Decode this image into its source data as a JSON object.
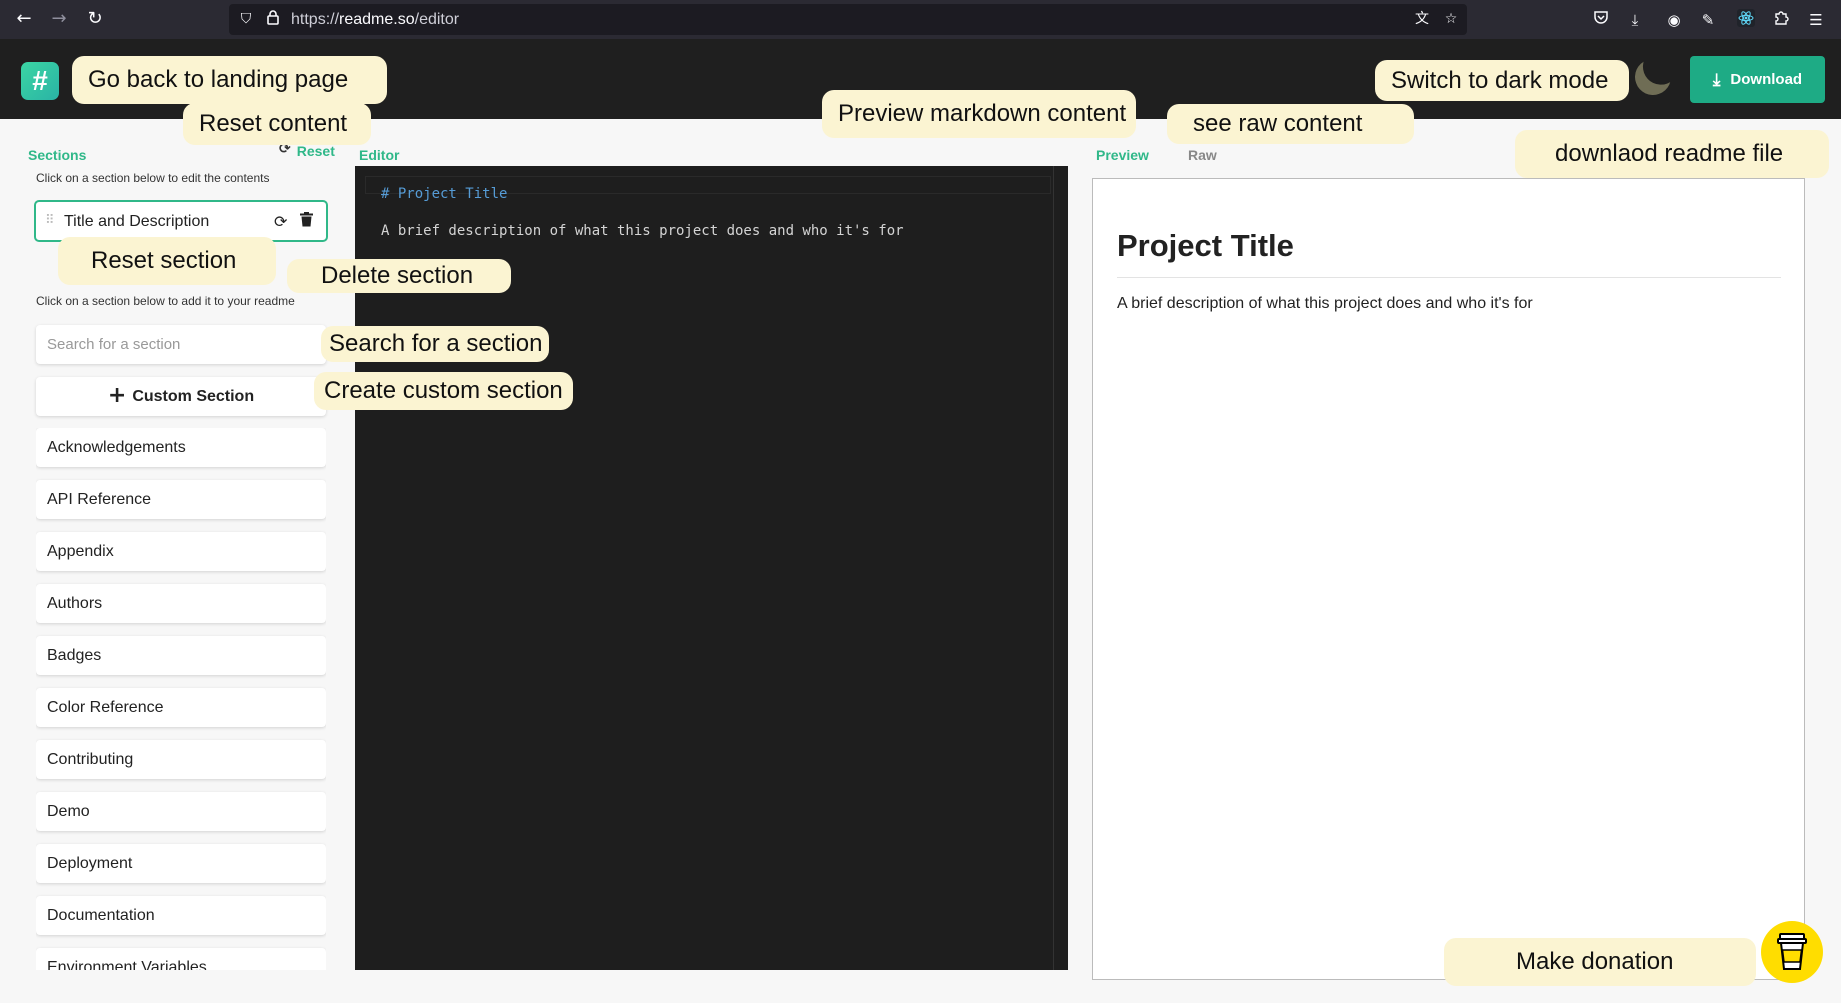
{
  "browser": {
    "url_scheme": "https://",
    "url_host": "readme.so",
    "url_path": "/editor",
    "icons": [
      "back-icon",
      "forward-icon",
      "reload-icon",
      "shield-icon",
      "lock-icon",
      "translate-icon",
      "bookmark-star-icon",
      "pocket-icon",
      "downloads-icon",
      "account-icon",
      "extension-feather-icon",
      "extension-react-icon",
      "extensions-icon",
      "menu-icon"
    ]
  },
  "header": {
    "logo_glyph": "#",
    "download_label": "Download",
    "accent_color": "#1eab85"
  },
  "sections_panel": {
    "title": "Sections",
    "reset_label": "Reset",
    "edit_hint": "Click on a section below to edit the contents",
    "selected_section": "Title and Description",
    "add_hint": "Click on a section below to add it to your readme",
    "search_placeholder": "Search for a section",
    "custom_section_label": "Custom Section",
    "available_sections": [
      "Acknowledgements",
      "API Reference",
      "Appendix",
      "Authors",
      "Badges",
      "Color Reference",
      "Contributing",
      "Demo",
      "Deployment",
      "Documentation",
      "Environment Variables"
    ]
  },
  "editor": {
    "title": "Editor",
    "lines": [
      "# Project Title",
      "A brief description of what this project does and who it's for"
    ]
  },
  "preview": {
    "tab_preview": "Preview",
    "tab_raw": "Raw",
    "heading": "Project Title",
    "body": "A brief description of what this project does and who it's for"
  },
  "annotations": {
    "landing": "Go back to landing page",
    "reset_content": "Reset content",
    "preview_md": "Preview markdown content",
    "raw": "see raw content",
    "dark_mode": "Switch to dark mode",
    "download": "downlaod readme file",
    "reset_section": "Reset section",
    "delete_section": "Delete section",
    "search": "Search for a section",
    "custom": "Create custom section",
    "donate": "Make donation"
  }
}
